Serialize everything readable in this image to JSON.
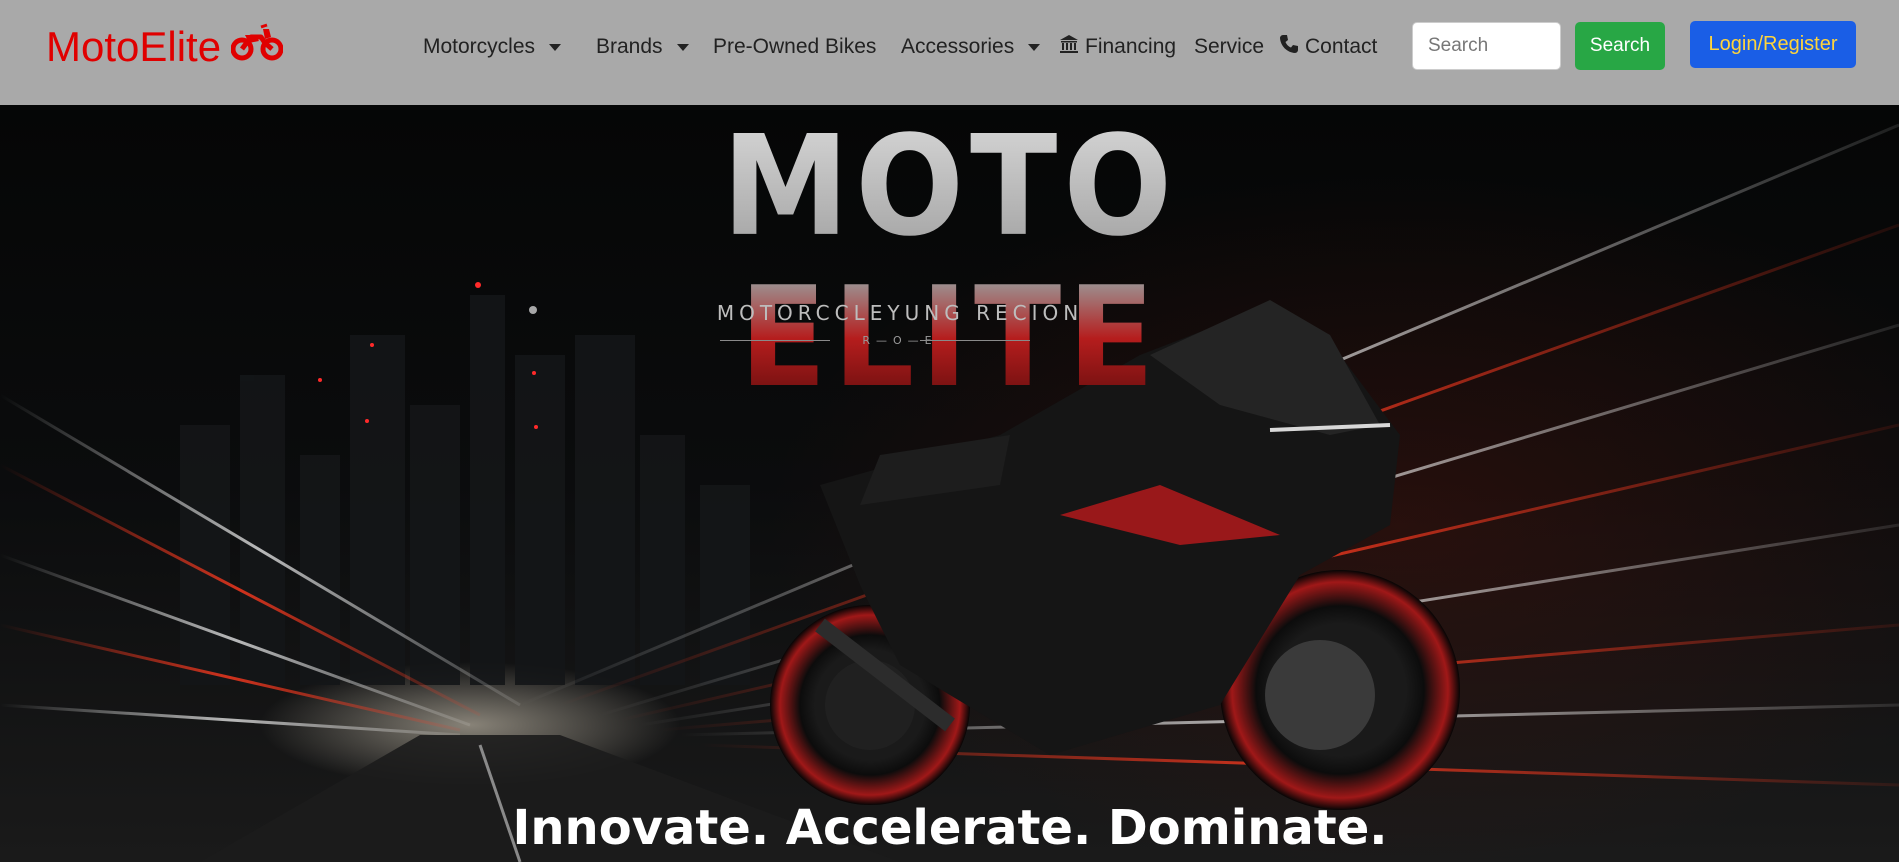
{
  "brand": {
    "name": "MotoElite",
    "icon": "motorcycle-icon",
    "color": "#e00000"
  },
  "nav": {
    "items": [
      {
        "label": "Motorcycles",
        "dropdown": true
      },
      {
        "label": "Brands",
        "dropdown": true
      },
      {
        "label": "Pre-Owned Bikes",
        "dropdown": false
      },
      {
        "label": "Accessories",
        "dropdown": true
      },
      {
        "label": "Financing",
        "icon": "bank-icon"
      },
      {
        "label": "Service"
      },
      {
        "label": "Contact",
        "icon": "phone-icon"
      }
    ]
  },
  "search": {
    "placeholder": "Search",
    "button_label": "Search"
  },
  "auth": {
    "login_label": "Login/Register"
  },
  "hero": {
    "logo_text": "MOTO ELITE",
    "subtitle": "MOTORCCLEYUNG RECION",
    "subtitle2": "R—O—E",
    "tagline": "Innovate. Accelerate. Dominate."
  },
  "colors": {
    "navbar_bg": "#a9a9a9",
    "search_button": "#28a745",
    "login_button": "#1a5ee6",
    "login_text": "#ffd43b"
  }
}
